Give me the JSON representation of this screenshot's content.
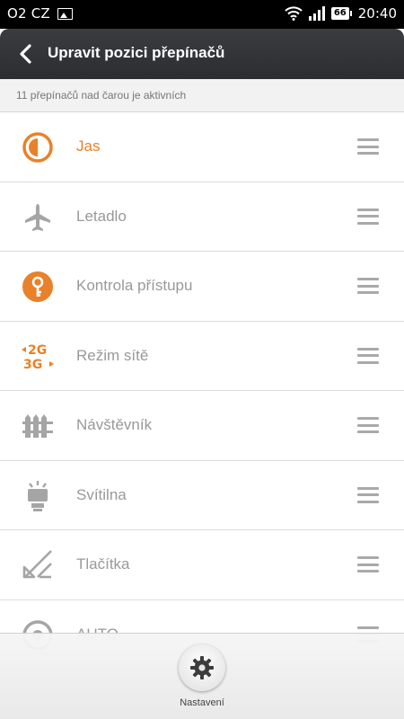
{
  "status_bar": {
    "carrier": "O2 CZ",
    "battery": "66",
    "time": "20:40",
    "icons": [
      "image-icon",
      "wifi-icon",
      "signal-icon",
      "battery-icon"
    ]
  },
  "header": {
    "title": "Upravit pozici přepínačů",
    "back_icon": "back-arrow-icon"
  },
  "subheader": {
    "text": "11 přepínačů nad čarou je aktivních"
  },
  "toggles": [
    {
      "label": "Jas",
      "icon": "brightness-icon",
      "active": true
    },
    {
      "label": "Letadlo",
      "icon": "airplane-icon",
      "active": false
    },
    {
      "label": "Kontrola přístupu",
      "icon": "key-icon",
      "active": false
    },
    {
      "label": "Režim sítě",
      "icon": "network-mode-icon",
      "active": false
    },
    {
      "label": "Návštěvník",
      "icon": "fence-icon",
      "active": false
    },
    {
      "label": "Svítilna",
      "icon": "flashlight-icon",
      "active": false
    },
    {
      "label": "Tlačítka",
      "icon": "buttons-icon",
      "active": false
    },
    {
      "label": "AUTO",
      "icon": "auto-icon",
      "active": false
    }
  ],
  "bottom": {
    "settings_label": "Nastavení",
    "settings_icon": "gear-icon"
  },
  "colors": {
    "accent": "#e8812a",
    "inactive_text": "#999999",
    "header_bg": "#2f3134"
  }
}
